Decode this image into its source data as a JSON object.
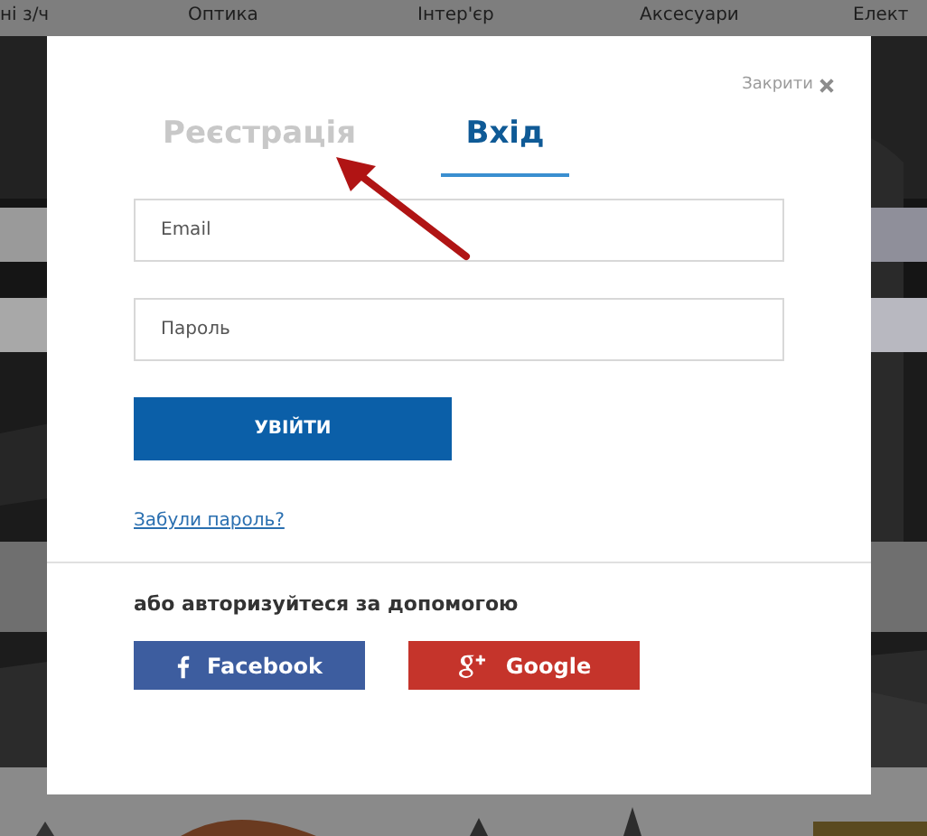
{
  "nav": [
    "ні з/ч",
    "Оптика",
    "Інтер'єр",
    "Аксесуари",
    "Елект"
  ],
  "dialog": {
    "close_label": "Закрити",
    "tabs": [
      {
        "label": "Реєстрація",
        "selected": false
      },
      {
        "label": "Вхід",
        "selected": true
      }
    ],
    "fields": [
      {
        "placeholder": "Email"
      },
      {
        "placeholder": "Пароль"
      }
    ],
    "submit": "УВІЙТИ",
    "forgot_link": "Забули пароль?",
    "social_prompt": "або авторизуйтеся за допомогою",
    "social_buttons": [
      {
        "kind": "facebook",
        "label": "Facebook"
      },
      {
        "kind": "google",
        "label": "Google"
      }
    ]
  }
}
